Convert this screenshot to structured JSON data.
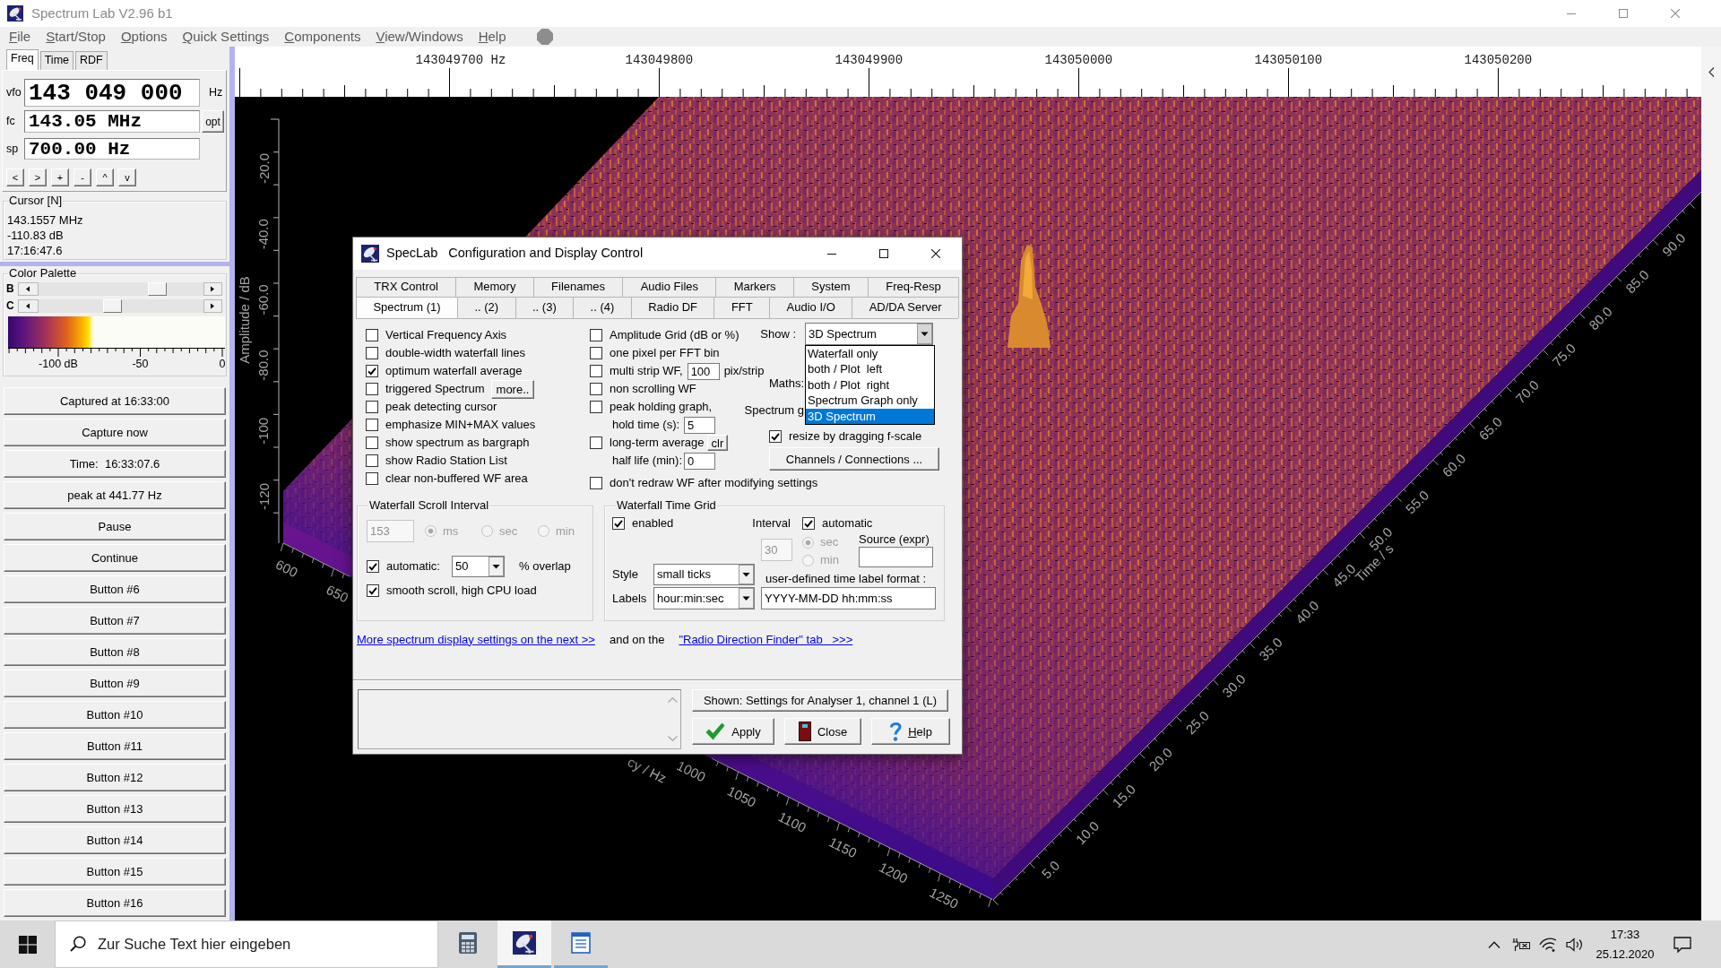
{
  "window": {
    "title": "Spectrum Lab V2.96 b1"
  },
  "menu": [
    "File",
    "Start/Stop",
    "Options",
    "Quick Settings",
    "Components",
    "View/Windows",
    "Help"
  ],
  "left_panel": {
    "tabs": [
      {
        "label": "Freq",
        "selected": true
      },
      {
        "label": "Time",
        "selected": false
      },
      {
        "label": "RDF",
        "selected": false
      }
    ],
    "vfo": {
      "label": "vfo",
      "value": "143 049 000",
      "unit": "Hz"
    },
    "fc": {
      "label": "fc",
      "value": "143.05 MHz",
      "button": "opt"
    },
    "sp": {
      "label": "sp",
      "value": "700.00 Hz"
    },
    "step_buttons": [
      "<",
      ">",
      "+",
      "-",
      "^",
      "v"
    ],
    "cursor": {
      "title": "Cursor [N]",
      "lines": [
        "143.1557 MHz",
        "-110.83 dB",
        "17:16:47.6"
      ]
    },
    "color_palette": {
      "title": "Color Palette",
      "sliders": [
        {
          "label": "B",
          "level": 0.75
        },
        {
          "label": "C",
          "level": 0.44
        }
      ],
      "scale_labels": [
        "-100 dB",
        "-50",
        "0"
      ]
    },
    "buttons": [
      "Captured at 16:33:00",
      "Capture now",
      "Time:  16:33:07.6",
      "peak at 441.77 Hz",
      "Pause",
      "Continue",
      "Button #6",
      "Button #7",
      "Button #8",
      "Button #9",
      "Button #10",
      "Button #11",
      "Button #12",
      "Button #13",
      "Button #14",
      "Button #15",
      "Button #16"
    ]
  },
  "spectrum_plot": {
    "frequency_scale": [
      "143049700 Hz",
      "143049800",
      "143049900",
      "143050000",
      "143050100",
      "143050200"
    ],
    "amplitude_axis": {
      "title": "Amplitude / dB",
      "labels": [
        "-20.0",
        "-40.0",
        "-60.0",
        "-80.0",
        "-100",
        "-120"
      ]
    },
    "frequency_axis": {
      "title": "cy / Hz",
      "near_labels": [
        "600",
        "650"
      ],
      "far_labels": [
        "1000",
        "1050",
        "1100",
        "1150",
        "1200",
        "1250"
      ]
    },
    "time_axis": {
      "title": "Time / s",
      "labels": [
        "5.0",
        "10.0",
        "15.0",
        "20.0",
        "25.0",
        "30.0",
        "35.0",
        "40.0",
        "45.0",
        "50.0",
        "55.0",
        "60.0",
        "65.0",
        "70.0",
        "75.0",
        "80.0",
        "85.0",
        "90.0"
      ]
    }
  },
  "dialog": {
    "title": "SpecLab   Configuration and Display Control",
    "tab_rows": [
      [
        {
          "label": "TRX Control",
          "selected": false
        },
        {
          "label": "Memory",
          "selected": false
        },
        {
          "label": "Filenames",
          "selected": false
        },
        {
          "label": "Audio Files",
          "selected": false
        },
        {
          "label": "Markers",
          "selected": false
        },
        {
          "label": "System",
          "selected": false
        },
        {
          "label": "Freq-Resp",
          "selected": false
        }
      ],
      [
        {
          "label": "Spectrum (1)",
          "selected": true
        },
        {
          "label": ".. (2)",
          "selected": false
        },
        {
          "label": ".. (3)",
          "selected": false
        },
        {
          "label": ".. (4)",
          "selected": false
        },
        {
          "label": "Radio DF",
          "selected": false
        },
        {
          "label": "FFT",
          "selected": false
        },
        {
          "label": "Audio I/O",
          "selected": false
        },
        {
          "label": "AD/DA Server",
          "selected": false
        }
      ]
    ],
    "options_left": [
      {
        "label": "Vertical Frequency Axis",
        "checked": false
      },
      {
        "label": "double-width waterfall lines",
        "checked": false
      },
      {
        "label": "optimum waterfall average",
        "checked": true
      },
      {
        "label": "triggered Spectrum",
        "checked": false,
        "button": "more.."
      },
      {
        "label": "peak detecting cursor",
        "checked": false
      },
      {
        "label": "emphasize MIN+MAX values",
        "checked": false
      },
      {
        "label": "show spectrum as bargraph",
        "checked": false
      },
      {
        "label": "show Radio Station List",
        "checked": false
      },
      {
        "label": "clear non-buffered WF area",
        "checked": false
      }
    ],
    "options_middle": [
      {
        "kind": "check",
        "label": "Amplitude Grid (dB or %)",
        "checked": false
      },
      {
        "kind": "check",
        "label": "one pixel per FFT bin",
        "checked": false
      },
      {
        "kind": "check",
        "label": "multi strip WF,",
        "checked": false,
        "value": "100",
        "unit": "pix/strip"
      },
      {
        "kind": "check",
        "label": "non scrolling WF",
        "checked": false
      },
      {
        "kind": "check",
        "label": "peak holding graph,",
        "checked": false
      },
      {
        "kind": "entry",
        "label": "hold time (s):",
        "value": "5"
      },
      {
        "kind": "check",
        "label": "long-term average",
        "checked": false,
        "button": "clr"
      },
      {
        "kind": "entry",
        "label": "half life (min):",
        "value": "0"
      }
    ],
    "option_bottom": {
      "label": "don't redraw WF after modifying settings",
      "checked": false
    },
    "show": {
      "label": "Show :",
      "value": "3D Spectrum",
      "expanded": true,
      "options": [
        {
          "label": "Waterfall only",
          "selected": false
        },
        {
          "label": "both / Plot  left",
          "selected": false
        },
        {
          "label": "both / Plot  right",
          "selected": false
        },
        {
          "label": "Spectrum Graph only",
          "selected": false
        },
        {
          "label": "3D Spectrum",
          "selected": true
        }
      ]
    },
    "maths_label": "Maths:",
    "spectrum_label": "Spectrum g",
    "resize": {
      "label": "resize by dragging f-scale",
      "checked": true
    },
    "channels_button": "Channels / Connections ...",
    "scroll_interval": {
      "title": "Waterfall Scroll Interval",
      "value": "153",
      "disabled": true,
      "units": [
        {
          "label": "ms",
          "selected": true
        },
        {
          "label": "sec",
          "selected": false
        },
        {
          "label": "min",
          "selected": false
        }
      ],
      "automatic": {
        "label": "automatic:",
        "checked": true
      },
      "overlap": {
        "value": "50",
        "unit": "% overlap"
      },
      "smooth": {
        "label": "smooth scroll, high CPU load",
        "checked": true
      }
    },
    "time_grid": {
      "title": "Waterfall Time Grid",
      "enabled": {
        "label": "enabled",
        "checked": true
      },
      "interval": {
        "label": "Interval",
        "value": "30",
        "disabled": true,
        "units": [
          {
            "label": "sec",
            "selected": true
          },
          {
            "label": "min",
            "selected": false
          }
        ]
      },
      "automatic": {
        "label": "automatic",
        "checked": true
      },
      "source": {
        "label": "Source (expr)"
      },
      "style": {
        "label": "Style",
        "value": "small ticks"
      },
      "labels": {
        "label": "Labels",
        "value": "hour:min:sec"
      },
      "format": {
        "label": "user-defined time label format :",
        "value": "YYYY-MM-DD hh:mm:ss"
      }
    },
    "links": [
      {
        "kind": "link",
        "text": "More spectrum display settings on the next >>"
      },
      {
        "kind": "text",
        "text": "and on the"
      },
      {
        "kind": "link",
        "text": "\"Radio Direction Finder\" tab   >>>"
      }
    ],
    "analyser_button": "Shown: Settings for Analyser 1, channel 1 (L)",
    "buttons": [
      {
        "kind": "apply",
        "label": "Apply",
        "mnemonic": false
      },
      {
        "kind": "close",
        "label": "Close",
        "mnemonic": false
      },
      {
        "kind": "help",
        "label": "Help",
        "mnemonic": true
      }
    ]
  },
  "taskbar": {
    "search": {
      "placeholder": "Zur Suche Text hier eingeben"
    },
    "apps": [
      {
        "kind": "calculator",
        "running": false,
        "selected": false
      },
      {
        "kind": "spectrum_lab",
        "running": true,
        "selected": true
      },
      {
        "kind": "notepad",
        "running": true,
        "selected": false
      }
    ],
    "clock": {
      "time": "17:33",
      "date": "25.12.2020"
    }
  }
}
